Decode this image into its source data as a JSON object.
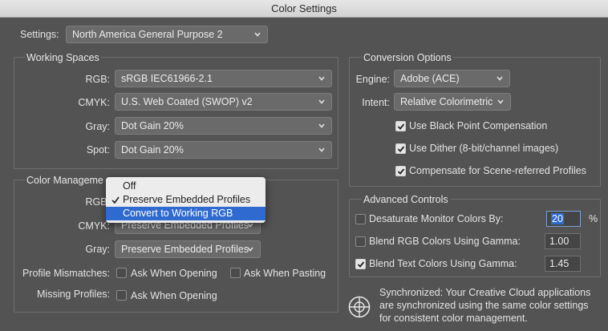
{
  "window": {
    "title": "Color Settings"
  },
  "settings": {
    "label": "Settings:",
    "value": "North America General Purpose 2"
  },
  "working_spaces": {
    "title": "Working Spaces",
    "rgb": {
      "label": "RGB:",
      "value": "sRGB IEC61966-2.1"
    },
    "cmyk": {
      "label": "CMYK:",
      "value": "U.S. Web Coated (SWOP) v2"
    },
    "gray": {
      "label": "Gray:",
      "value": "Dot Gain 20%"
    },
    "spot": {
      "label": "Spot:",
      "value": "Dot Gain 20%"
    }
  },
  "color_management": {
    "title": "Color Manageme",
    "rgb": {
      "label": "RGB:"
    },
    "cmyk": {
      "label": "CMYK:",
      "value": "Preserve Embedded Profiles"
    },
    "gray": {
      "label": "Gray:",
      "value": "Preserve Embedded Profiles"
    },
    "profile_mismatches": {
      "label": "Profile Mismatches:",
      "ask_opening": {
        "label": "Ask When Opening",
        "checked": false
      },
      "ask_pasting": {
        "label": "Ask When Pasting",
        "checked": false
      }
    },
    "missing_profiles": {
      "label": "Missing Profiles:",
      "ask_opening": {
        "label": "Ask When Opening",
        "checked": false
      }
    }
  },
  "rgb_policy_menu": {
    "items": [
      {
        "label": "Off",
        "checked": false,
        "highlighted": false
      },
      {
        "label": "Preserve Embedded Profiles",
        "checked": true,
        "highlighted": false
      },
      {
        "label": "Convert to Working RGB",
        "checked": false,
        "highlighted": true
      }
    ]
  },
  "conversion_options": {
    "title": "Conversion Options",
    "engine": {
      "label": "Engine:",
      "value": "Adobe (ACE)"
    },
    "intent": {
      "label": "Intent:",
      "value": "Relative Colorimetric"
    },
    "black_point": {
      "label": "Use Black Point Compensation",
      "checked": true
    },
    "dither": {
      "label": "Use Dither (8-bit/channel images)",
      "checked": true
    },
    "scene_referred": {
      "label": "Compensate for Scene-referred Profiles",
      "checked": true
    }
  },
  "advanced_controls": {
    "title": "Advanced Controls",
    "desaturate": {
      "label": "Desaturate Monitor Colors By:",
      "checked": false,
      "value": "20",
      "unit": "%"
    },
    "blend_rgb": {
      "label": "Blend RGB Colors Using Gamma:",
      "checked": false,
      "value": "1.00"
    },
    "blend_text": {
      "label": "Blend Text Colors Using Gamma:",
      "checked": true,
      "value": "1.45"
    }
  },
  "sync": {
    "icon": "sync-globe-icon",
    "lines": [
      "Synchronized: Your Creative Cloud applications",
      "are synchronized using the same color settings",
      "for consistent color management."
    ]
  },
  "colors": {
    "background": "#535353",
    "accent": "#2f6ad0",
    "menu_bg": "#ececec"
  }
}
